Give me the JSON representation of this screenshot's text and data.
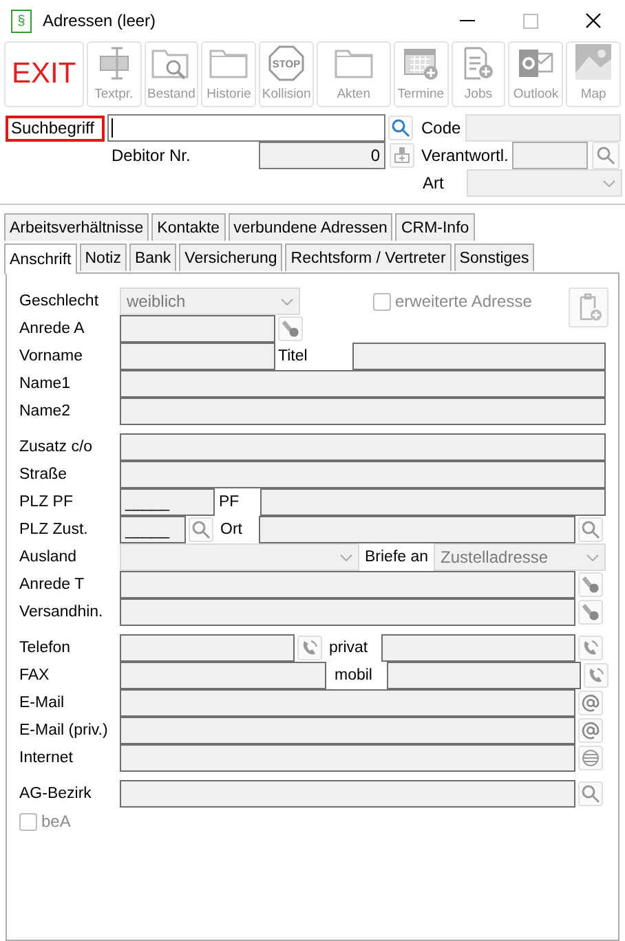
{
  "window": {
    "title": "Adressen (leer)",
    "icon_text": "§"
  },
  "toolbar": [
    {
      "kind": "exit",
      "label": "EXIT",
      "disabled": false
    },
    {
      "kind": "text",
      "label": "Textpr.",
      "disabled": true
    },
    {
      "kind": "stock",
      "label": "Bestand",
      "disabled": true
    },
    {
      "kind": "history",
      "label": "Historie",
      "disabled": true
    },
    {
      "kind": "collision",
      "label": "Kollision",
      "icon_text": "STOP",
      "disabled": true
    },
    {
      "kind": "files",
      "label": "Akten",
      "disabled": true
    },
    {
      "kind": "calendar",
      "label": "Termine",
      "disabled": true
    },
    {
      "kind": "jobs",
      "label": "Jobs",
      "disabled": true
    },
    {
      "kind": "mail",
      "label": "Outlook",
      "disabled": true
    },
    {
      "kind": "map",
      "label": "Map",
      "disabled": true
    }
  ],
  "header": {
    "search_label": "Suchbegriff",
    "code_label": "Code",
    "debitor_label": "Debitor Nr.",
    "debitor_value": "0",
    "responsible_label": "Verantwortl.",
    "type_label": "Art"
  },
  "tabs_top": [
    {
      "label": "Arbeitsverhältnisse",
      "selected": false
    },
    {
      "label": "Kontakte",
      "selected": false
    },
    {
      "label": "verbundene Adressen",
      "selected": false
    },
    {
      "label": "CRM-Info",
      "selected": false
    }
  ],
  "tabs": [
    {
      "label": "Anschrift",
      "selected": true
    },
    {
      "label": "Notiz",
      "selected": false
    },
    {
      "label": "Bank",
      "selected": false
    },
    {
      "label": "Versicherung",
      "selected": false
    },
    {
      "label": "Rechtsform / Vertreter",
      "selected": false
    },
    {
      "label": "Sonstiges",
      "selected": false
    }
  ],
  "form": {
    "groups": [
      [
        {
          "kind": "select-check",
          "label": "Geschlecht",
          "parts": [
            {
              "kind": "select",
              "value": "weiblich"
            },
            {
              "kind": "checkbox",
              "label": "erweiterte Adresse",
              "checked": false
            },
            {
              "kind": "clipboard"
            }
          ]
        },
        {
          "kind": "short-button",
          "label": "Anrede A",
          "parts": [
            {
              "kind": "field"
            },
            {
              "kind": "key"
            }
          ]
        },
        {
          "kind": "short-label-field",
          "label": "Vorname",
          "parts": [
            {
              "kind": "field"
            },
            {
              "kind": "label",
              "label": "Titel"
            },
            {
              "kind": "field"
            }
          ]
        },
        {
          "kind": "full",
          "label": "Name1",
          "parts": [
            {
              "kind": "field"
            }
          ]
        },
        {
          "kind": "full",
          "label": "Name2",
          "parts": [
            {
              "kind": "field"
            }
          ]
        }
      ],
      [
        {
          "kind": "full",
          "label": "Zusatz  c/o",
          "parts": [
            {
              "kind": "field"
            }
          ]
        },
        {
          "kind": "full",
          "label": "Straße",
          "parts": [
            {
              "kind": "field"
            }
          ]
        },
        {
          "kind": "plz-pf",
          "label": "PLZ PF",
          "parts": [
            {
              "kind": "field",
              "value": "_____"
            },
            {
              "kind": "label",
              "label": "PF"
            },
            {
              "kind": "field"
            }
          ]
        },
        {
          "kind": "plz-city",
          "label": "PLZ Zust.",
          "parts": [
            {
              "kind": "field",
              "value": "_____"
            },
            {
              "kind": "search"
            },
            {
              "kind": "label",
              "label": "Ort"
            },
            {
              "kind": "field"
            },
            {
              "kind": "search"
            }
          ]
        },
        {
          "kind": "select-label-select",
          "label": "Ausland",
          "parts": [
            {
              "kind": "select"
            },
            {
              "kind": "label",
              "label": "Briefe an"
            },
            {
              "kind": "select",
              "value": "Zustelladresse"
            }
          ]
        },
        {
          "kind": "field-button",
          "label": "Anrede T",
          "parts": [
            {
              "kind": "field"
            },
            {
              "kind": "key"
            }
          ]
        },
        {
          "kind": "field-button",
          "label": "Versandhin.",
          "parts": [
            {
              "kind": "field"
            },
            {
              "kind": "key"
            }
          ]
        }
      ],
      [
        {
          "kind": "phone",
          "label": "Telefon",
          "parts": [
            {
              "kind": "field"
            },
            {
              "kind": "phone"
            },
            {
              "kind": "label",
              "label": "privat"
            },
            {
              "kind": "field"
            },
            {
              "kind": "phone"
            }
          ]
        },
        {
          "kind": "fax",
          "label": "FAX",
          "parts": [
            {
              "kind": "field"
            },
            {
              "kind": "label",
              "label": "mobil"
            },
            {
              "kind": "field"
            },
            {
              "kind": "phone"
            }
          ]
        },
        {
          "kind": "field-button",
          "label": "E-Mail",
          "parts": [
            {
              "kind": "field"
            },
            {
              "kind": "at"
            }
          ]
        },
        {
          "kind": "field-button",
          "label": "E-Mail (priv.)",
          "parts": [
            {
              "kind": "field"
            },
            {
              "kind": "at"
            }
          ]
        },
        {
          "kind": "field-button",
          "label": "Internet",
          "parts": [
            {
              "kind": "field"
            },
            {
              "kind": "globe"
            }
          ]
        }
      ],
      [
        {
          "kind": "field-button",
          "label": "AG-Bezirk",
          "parts": [
            {
              "kind": "field"
            },
            {
              "kind": "search"
            }
          ]
        },
        {
          "kind": "check",
          "parts": [
            {
              "kind": "checkbox",
              "label": "beA",
              "checked": false
            }
          ]
        }
      ]
    ]
  }
}
